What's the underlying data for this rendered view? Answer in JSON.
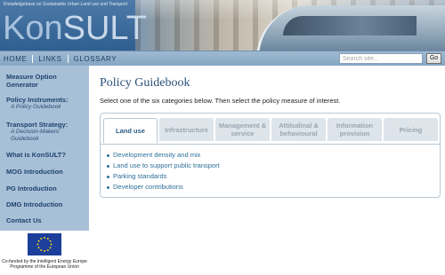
{
  "header": {
    "tagline": "Knowledgebase on Sustainable Urban Land use and Transport",
    "logo_light": "Kon",
    "logo_bold": "SULT"
  },
  "nav": {
    "links": [
      "HOME",
      "LINKS",
      "GLOSSARY"
    ],
    "search_placeholder": "Search site...",
    "go_label": "Go"
  },
  "sidebar": {
    "items": [
      {
        "label": "Measure Option Generator",
        "sub": ""
      },
      {
        "label": "Policy Instruments:",
        "sub": "A Policy Guidebook"
      },
      {
        "label": "Transport Strategy:",
        "sub": "A Decision-Makers' Guidebook"
      },
      {
        "label": "What is KonSULT?",
        "sub": ""
      },
      {
        "label": "MOG Introduction",
        "sub": ""
      },
      {
        "label": "PG Introduction",
        "sub": ""
      },
      {
        "label": "DMG Introduction",
        "sub": ""
      },
      {
        "label": "Contact Us",
        "sub": ""
      }
    ],
    "eu_caption_line1": "Co-funded by the Intelligent Energy Europe",
    "eu_caption_line2": "Programme of the European Union"
  },
  "main": {
    "title": "Policy Guidebook",
    "instructions": "Select one of the six categories below. Then select the policy measure of interest.",
    "tabs": [
      {
        "label": "Land use",
        "active": true
      },
      {
        "label": "Infrastructure",
        "active": false
      },
      {
        "label": "Management & service",
        "active": false
      },
      {
        "label": "Attitudinal & behavioural",
        "active": false
      },
      {
        "label": "Information provision",
        "active": false
      },
      {
        "label": "Pricing",
        "active": false
      }
    ],
    "measures": [
      "Development density and mix",
      "Land use to support public transport",
      "Parking standards",
      "Developer contributions"
    ]
  },
  "colors": {
    "sidebar_bg": "#a7c0d8",
    "nav_bg": "#9fbad2",
    "title": "#2a4f7a",
    "link": "#2b6d97"
  }
}
